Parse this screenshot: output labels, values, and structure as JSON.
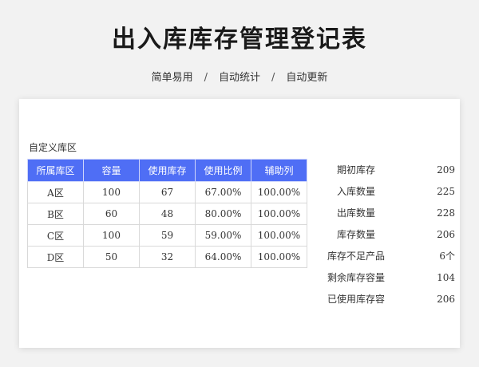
{
  "header": {
    "title": "出入库库存管理登记表",
    "tags": [
      "简单易用",
      "自动统计",
      "自动更新"
    ],
    "separator": "/"
  },
  "region_label": "自定义库区",
  "table": {
    "columns": [
      "所属库区",
      "容量",
      "使用库存",
      "使用比例",
      "辅助列"
    ],
    "rows": [
      [
        "A区",
        "100",
        "67",
        "67.00%",
        "100.00%"
      ],
      [
        "B区",
        "60",
        "48",
        "80.00%",
        "100.00%"
      ],
      [
        "C区",
        "100",
        "59",
        "59.00%",
        "100.00%"
      ],
      [
        "D区",
        "50",
        "32",
        "64.00%",
        "100.00%"
      ]
    ]
  },
  "stats": [
    {
      "label": "期初库存",
      "value": "209"
    },
    {
      "label": "入库数量",
      "value": "225"
    },
    {
      "label": "出库数量",
      "value": "228"
    },
    {
      "label": "库存数量",
      "value": "206"
    },
    {
      "label": "库存不足产品",
      "value": "6个"
    },
    {
      "label": "剩余库存容量",
      "value": "104"
    },
    {
      "label": "已使用库存容",
      "value": "206"
    }
  ],
  "colors": {
    "header_bg": "#4f6ef5",
    "page_bg": "#f2f2f2"
  }
}
